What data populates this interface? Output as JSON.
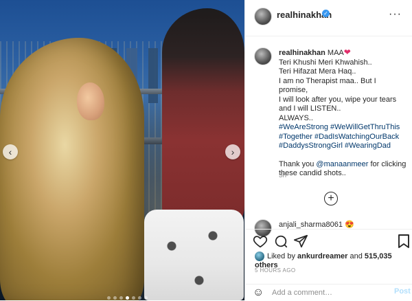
{
  "header": {
    "username": "realhinakhan",
    "more_label": "···"
  },
  "caption": {
    "username": "realhinakhan",
    "first_line": "MAA",
    "heart": "❤",
    "lines": [
      "Teri Khushi Meri Khwahish..",
      "Teri Hifazat Mera Haq..",
      "I am no Therapist maa.. But I promise,",
      "I will look after you, wipe your tears",
      "and I will LISTEN..",
      "ALWAYS.."
    ],
    "hashtags": [
      "#WeAreStrong #WeWillGetThruThis",
      "#Together #DadIsWatchingOurBack",
      "#DaddysStrongGirl #WearingDad"
    ],
    "thanks_prefix": "Thank you ",
    "mention": "@manaanmeer",
    "thanks_suffix": " for clicking",
    "thanks_line2": "these candid shots..",
    "time_ago": "5h"
  },
  "comment_peek": {
    "text": "anjali_sharma8061 😍"
  },
  "actions": {
    "like": "heart",
    "comment": "speech-bubble",
    "share": "paper-plane",
    "save": "bookmark"
  },
  "likes": {
    "prefix": "Liked by ",
    "user": "ankurdreamer",
    "middle": " and ",
    "count": "515,035 others"
  },
  "post_date": "5 HOURS AGO",
  "add_comment": {
    "placeholder": "Add a comment…",
    "post_label": "Post"
  },
  "carousel": {
    "total_slides": 7,
    "active_index": 3
  }
}
